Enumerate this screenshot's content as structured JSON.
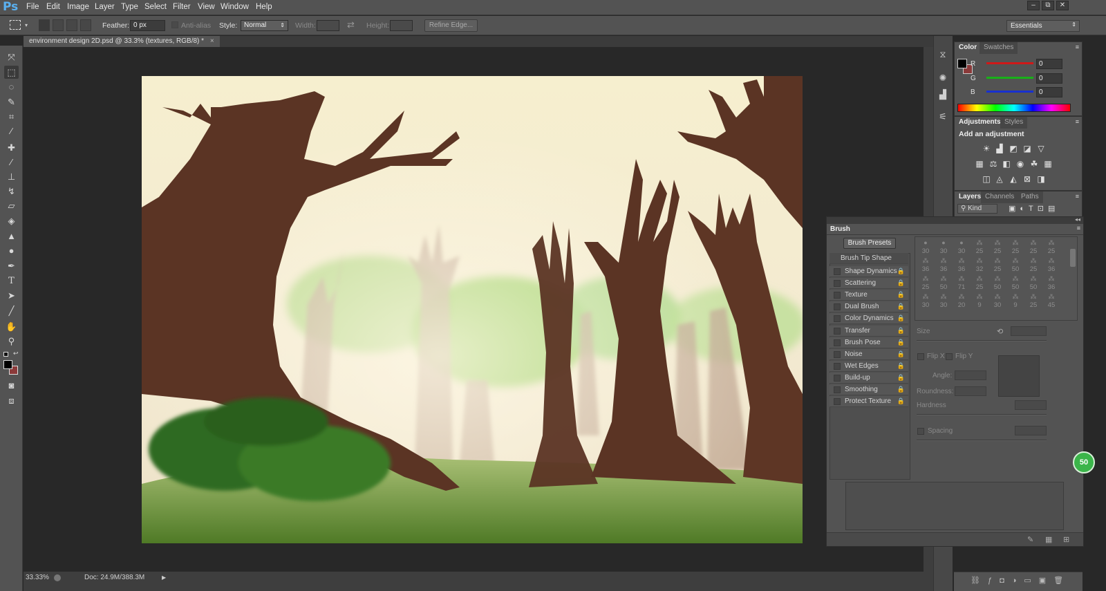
{
  "app": {
    "logo": "Ps",
    "menus": [
      "File",
      "Edit",
      "Image",
      "Layer",
      "Type",
      "Select",
      "Filter",
      "View",
      "Window",
      "Help"
    ]
  },
  "window_controls": {
    "minimize": "–",
    "restore": "⧉",
    "close": "✕"
  },
  "options": {
    "feather_label": "Feather:",
    "feather_value": "0 px",
    "antialias_label": "Anti-alias",
    "style_label": "Style:",
    "style_value": "Normal",
    "width_label": "Width:",
    "height_label": "Height:",
    "refine_edge": "Refine Edge...",
    "workspace": "Essentials"
  },
  "document": {
    "tab_title": "environment design 2D.psd @ 33.3% (textures, RGB/8) *",
    "tab_close": "×",
    "zoom": "33.33%",
    "doc_info": "Doc: 24.9M/388.3M"
  },
  "color_panel": {
    "tabs": [
      "Color",
      "Swatches"
    ],
    "channels": [
      {
        "label": "R",
        "value": "0",
        "color": "#d01818"
      },
      {
        "label": "G",
        "value": "0",
        "color": "#18b018"
      },
      {
        "label": "B",
        "value": "0",
        "color": "#1830d0"
      }
    ],
    "foreground": "#000000",
    "background": "#8b3a3a"
  },
  "adjustments_panel": {
    "tabs": [
      "Adjustments",
      "Styles"
    ],
    "heading": "Add an adjustment"
  },
  "layers_panel": {
    "tabs": [
      "Layers",
      "Channels",
      "Paths"
    ],
    "filter": "Kind"
  },
  "brush_panel": {
    "title": "Brush",
    "presets_button": "Brush Presets",
    "tip_shape": "Brush Tip Shape",
    "options": [
      "Shape Dynamics",
      "Scattering",
      "Texture",
      "Dual Brush",
      "Color Dynamics",
      "Transfer",
      "Brush Pose",
      "Noise",
      "Wet Edges",
      "Build-up",
      "Smoothing",
      "Protect Texture"
    ],
    "tip_rows": [
      [
        "30",
        "30",
        "30",
        "25",
        "25",
        "25",
        "25",
        "25"
      ],
      [
        "36",
        "36",
        "36",
        "32",
        "25",
        "50",
        "25",
        "36"
      ],
      [
        "25",
        "50",
        "71",
        "25",
        "50",
        "50",
        "50",
        "36"
      ],
      [
        "30",
        "30",
        "20",
        "9",
        "30",
        "9",
        "25",
        "45"
      ]
    ],
    "size_label": "Size",
    "flip_x": "Flip X",
    "flip_y": "Flip Y",
    "angle_label": "Angle:",
    "roundness_label": "Roundness:",
    "hardness_label": "Hardness",
    "spacing_label": "Spacing"
  },
  "badge": "50"
}
